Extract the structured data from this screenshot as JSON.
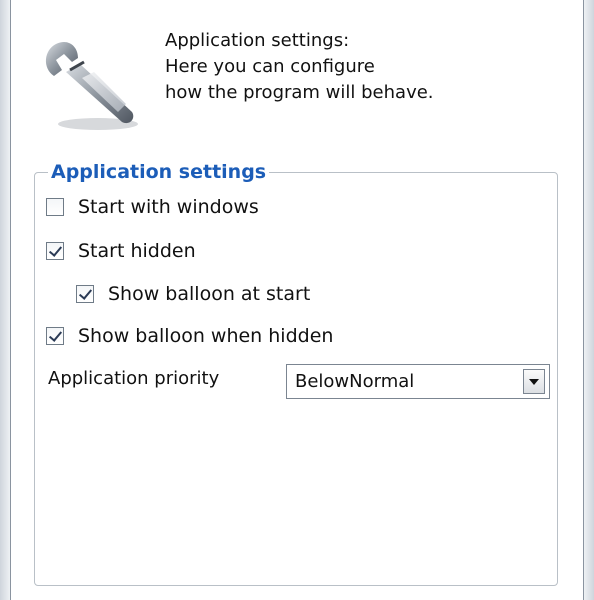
{
  "header": {
    "icon": "wrench-settings-icon",
    "lines": [
      "Application settings:",
      "Here you can configure",
      "how the program will behave."
    ]
  },
  "group": {
    "title": "Application settings",
    "options": [
      {
        "label": "Start with windows",
        "checked": false
      },
      {
        "label": "Start hidden",
        "checked": true
      },
      {
        "label": "Show balloon at start",
        "checked": true
      },
      {
        "label": "Show balloon when hidden",
        "checked": true
      }
    ],
    "priority": {
      "label": "Application priority",
      "value": "BelowNormal"
    }
  },
  "colors": {
    "group_title": "#1c5db8",
    "border": "#b9c0c7"
  }
}
